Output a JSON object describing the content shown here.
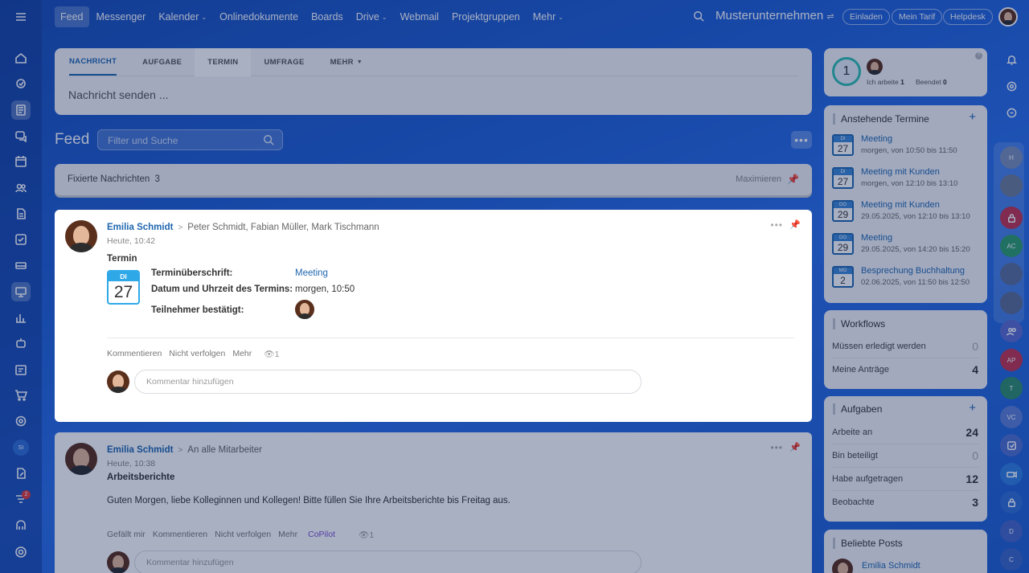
{
  "topnav": {
    "items": [
      {
        "label": "Feed",
        "active": true,
        "caret": false
      },
      {
        "label": "Messenger",
        "caret": false
      },
      {
        "label": "Kalender",
        "caret": true
      },
      {
        "label": "Onlinedokumente",
        "caret": false
      },
      {
        "label": "Boards",
        "caret": false
      },
      {
        "label": "Drive",
        "caret": true
      },
      {
        "label": "Webmail",
        "caret": false
      },
      {
        "label": "Projektgruppen",
        "caret": false
      },
      {
        "label": "Mehr",
        "caret": true
      }
    ],
    "company": "Musterunternehmen",
    "invite": "Einladen",
    "tariff": "Mein Tarif",
    "helpdesk": "Helpdesk"
  },
  "leftrail": {
    "icons": [
      "menu-icon",
      "home-icon",
      "tasks-icon",
      "feed-icon",
      "chat-icon",
      "calendar-icon",
      "users-icon",
      "document-icon",
      "checkbox-icon",
      "drive-icon",
      "board-icon",
      "chart-icon",
      "robot-icon",
      "planner-icon",
      "cart-icon",
      "target-icon",
      "si-avatar",
      "doc-edit-icon",
      "filter-icon",
      "api-icon",
      "settings-icon"
    ],
    "si_initials": "SI",
    "notification_count": "2"
  },
  "composer": {
    "tabs": [
      "NACHRICHT",
      "AUFGABE",
      "TERMIN",
      "UMFRAGE",
      "MEHR"
    ],
    "placeholder": "Nachricht senden ..."
  },
  "feed": {
    "title": "Feed",
    "filter_placeholder": "Filter und Suche",
    "pinned_label": "Fixierte Nachrichten",
    "pinned_count": "3",
    "maximize": "Maximieren"
  },
  "post1": {
    "author": "Emilia Schmidt",
    "recipients": "Peter Schmidt, Fabian Müller, Mark Tischmann",
    "time": "Heute, 10:42",
    "topic": "Termin",
    "cal_day": "DI",
    "cal_num": "27",
    "label_title": "Terminüberschrift:",
    "value_title": "Meeting",
    "label_date": "Datum und Uhrzeit des Termins:",
    "value_date": "morgen, 10:50",
    "label_participants": "Teilnehmer bestätigt:",
    "actions": [
      "Kommentieren",
      "Nicht verfolgen",
      "Mehr"
    ],
    "views": "1",
    "comment_placeholder": "Kommentar hinzufügen"
  },
  "post2": {
    "author": "Emilia Schmidt",
    "recipients": "An alle Mitarbeiter",
    "time": "Heute, 10:38",
    "topic": "Arbeitsberichte",
    "text": "Guten Morgen, liebe Kolleginnen und Kollegen! Bitte füllen Sie Ihre Arbeitsberichte bis Freitag aus.",
    "actions": [
      "Gefällt mir",
      "Kommentieren",
      "Nicht verfolgen",
      "Mehr"
    ],
    "copilot": "CoPilot",
    "views": "1",
    "comment_placeholder": "Kommentar hinzufügen"
  },
  "worktime": {
    "count": "1",
    "working_label": "Ich arbeite",
    "working_value": "1",
    "done_label": "Beendet",
    "done_value": "0"
  },
  "events": {
    "title": "Anstehende Termine",
    "items": [
      {
        "day": "DI",
        "num": "27",
        "title": "Meeting",
        "sub": "morgen, von 10:50 bis 11:50"
      },
      {
        "day": "DI",
        "num": "27",
        "title": "Meeting mit Kunden",
        "sub": "morgen, von 12:10 bis 13:10"
      },
      {
        "day": "DO",
        "num": "29",
        "title": "Meeting mit Kunden",
        "sub": "29.05.2025, von 12:10 bis 13:10"
      },
      {
        "day": "DO",
        "num": "29",
        "title": "Meeting",
        "sub": "29.05.2025, von 14:20 bis 15:20"
      },
      {
        "day": "MO",
        "num": "2",
        "title": "Besprechung Buchhaltung",
        "sub": "02.06.2025, von 11:50 bis 12:50"
      }
    ]
  },
  "workflows": {
    "title": "Workflows",
    "rows": [
      {
        "label": "Müssen erledigt werden",
        "value": "0"
      },
      {
        "label": "Meine Anträge",
        "value": "4"
      }
    ]
  },
  "tasks": {
    "title": "Aufgaben",
    "rows": [
      {
        "label": "Arbeite an",
        "value": "24"
      },
      {
        "label": "Bin beteiligt",
        "value": "0"
      },
      {
        "label": "Habe aufgetragen",
        "value": "12"
      },
      {
        "label": "Beobachte",
        "value": "3"
      }
    ]
  },
  "popular": {
    "title": "Beliebte Posts",
    "author": "Emilia Schmidt"
  },
  "rightrail": {
    "initials": [
      "H",
      "AC",
      "AP",
      "T",
      "VC",
      "D",
      "C"
    ]
  },
  "colors": {
    "accent": "#2067b0",
    "highlight_tab": "#ffffff",
    "calendar": "#2fa8e8",
    "copilot": "#7b4fd1"
  }
}
